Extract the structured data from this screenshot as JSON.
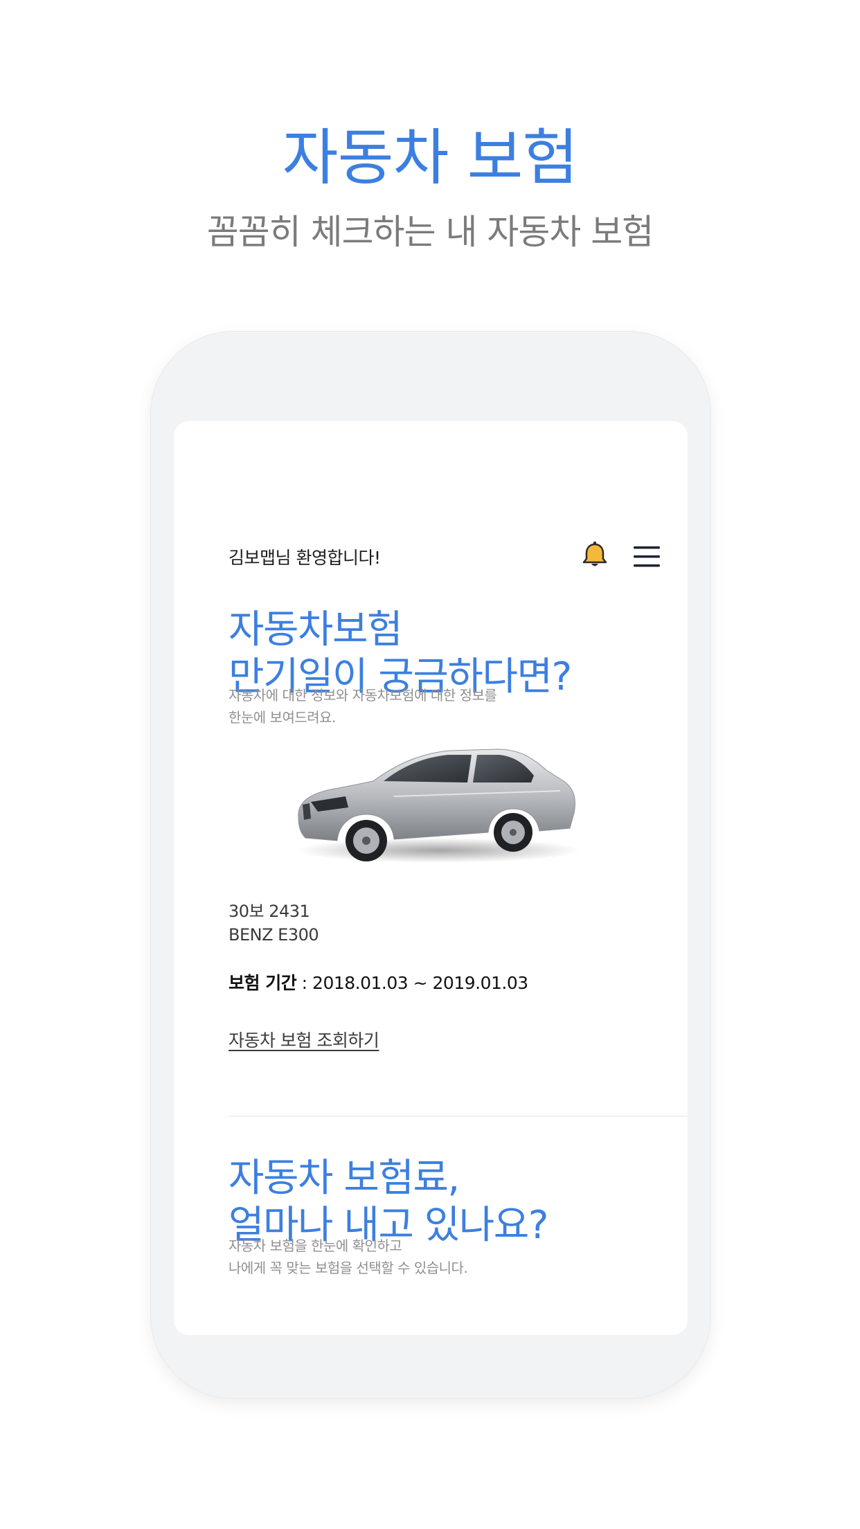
{
  "promo": {
    "title": "자동차 보험",
    "subtitle": "꼼꼼히 체크하는 내 자동차 보험"
  },
  "header": {
    "welcome": "김보맵님 환영합니다!",
    "bell_icon": "bell-icon",
    "menu_icon": "hamburger-menu-icon"
  },
  "section1": {
    "headline_line1": "자동차보험",
    "headline_line2": "만기일이 궁금하다면?",
    "desc_line1": "자동차에 대한 정보와 자동차보험에 대한 정보를",
    "desc_line2": "한눈에 보여드려요."
  },
  "vehicle": {
    "plate": "30보 2431",
    "model": "BENZ E300",
    "period_label": "보험 기간",
    "period_value": " : 2018.01.03 ~ 2019.01.03",
    "link": "자동차 보험 조회하기"
  },
  "section2": {
    "headline_line1": "자동차 보험료,",
    "headline_line2": "얼마나 내고 있나요?",
    "desc_line1": "자동차 보험을 한눈에 확인하고",
    "desc_line2": "나에게 꼭 맞는 보험을 선택할 수 있습니다."
  },
  "colors": {
    "accent": "#3c7fe0",
    "bell": "#f5b93a"
  }
}
